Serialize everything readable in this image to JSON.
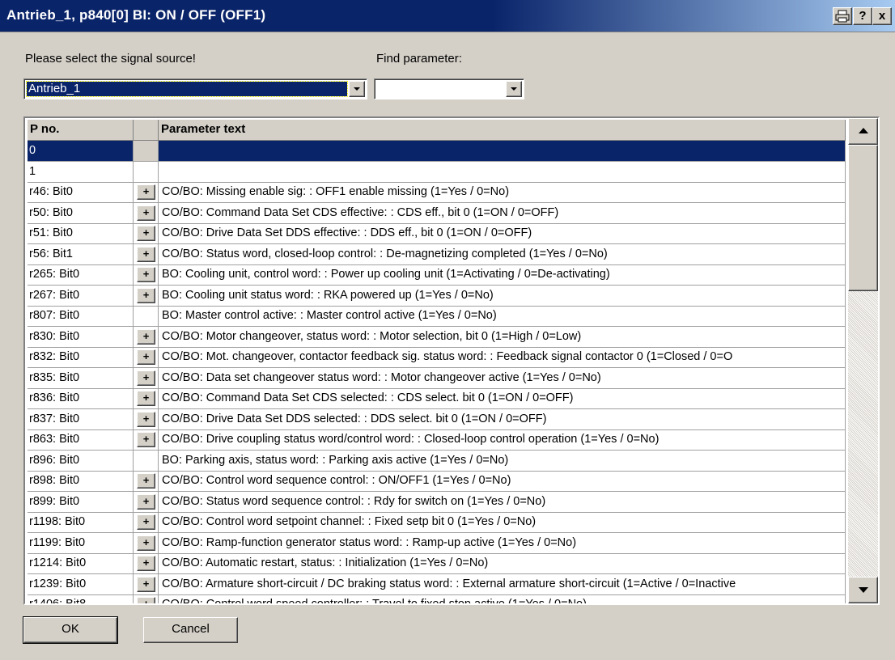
{
  "window": {
    "title": "Antrieb_1, p840[0] BI: ON / OFF (OFF1)",
    "buttons": {
      "print_icon": "printer-icon",
      "help": "?",
      "close": "x"
    }
  },
  "source": {
    "label": "Please select the signal source!",
    "value": "Antrieb_1"
  },
  "find": {
    "label": "Find parameter:",
    "value": ""
  },
  "table": {
    "columns": [
      "P no.",
      "",
      "Parameter text"
    ],
    "rows": [
      {
        "pno": "0",
        "expand": false,
        "text": "",
        "selected": true
      },
      {
        "pno": "1",
        "expand": false,
        "text": ""
      },
      {
        "pno": "r46: Bit0",
        "expand": true,
        "text": "CO/BO: Missing enable sig: : OFF1 enable missing (1=Yes / 0=No)"
      },
      {
        "pno": "r50: Bit0",
        "expand": true,
        "text": "CO/BO: Command Data Set CDS effective: : CDS eff., bit 0 (1=ON / 0=OFF)"
      },
      {
        "pno": "r51: Bit0",
        "expand": true,
        "text": "CO/BO: Drive Data Set DDS effective: : DDS eff., bit 0 (1=ON / 0=OFF)"
      },
      {
        "pno": "r56: Bit1",
        "expand": true,
        "text": "CO/BO: Status word, closed-loop control: : De-magnetizing completed (1=Yes / 0=No)"
      },
      {
        "pno": "r265: Bit0",
        "expand": true,
        "text": "BO: Cooling unit, control word: : Power up cooling unit (1=Activating / 0=De-activating)"
      },
      {
        "pno": "r267: Bit0",
        "expand": true,
        "text": "BO: Cooling unit status word: : RKA powered up (1=Yes / 0=No)"
      },
      {
        "pno": "r807: Bit0",
        "expand": false,
        "text": "BO: Master control active: : Master control active (1=Yes / 0=No)"
      },
      {
        "pno": "r830: Bit0",
        "expand": true,
        "text": "CO/BO: Motor changeover, status word: : Motor selection, bit 0 (1=High / 0=Low)"
      },
      {
        "pno": "r832: Bit0",
        "expand": true,
        "text": "CO/BO: Mot. changeover, contactor feedback sig. status word: : Feedback signal contactor 0 (1=Closed / 0=O"
      },
      {
        "pno": "r835: Bit0",
        "expand": true,
        "text": "CO/BO: Data set changeover status word: : Motor changeover active (1=Yes / 0=No)"
      },
      {
        "pno": "r836: Bit0",
        "expand": true,
        "text": "CO/BO: Command Data Set CDS selected: : CDS select. bit 0 (1=ON / 0=OFF)"
      },
      {
        "pno": "r837: Bit0",
        "expand": true,
        "text": "CO/BO: Drive Data Set DDS selected: : DDS select. bit 0 (1=ON / 0=OFF)"
      },
      {
        "pno": "r863: Bit0",
        "expand": true,
        "text": "CO/BO: Drive coupling status word/control word: : Closed-loop control operation (1=Yes / 0=No)"
      },
      {
        "pno": "r896: Bit0",
        "expand": false,
        "text": "BO: Parking axis, status word: : Parking axis active (1=Yes / 0=No)"
      },
      {
        "pno": "r898: Bit0",
        "expand": true,
        "text": "CO/BO: Control word sequence control: : ON/OFF1 (1=Yes / 0=No)"
      },
      {
        "pno": "r899: Bit0",
        "expand": true,
        "text": "CO/BO: Status word sequence control: : Rdy for switch on (1=Yes / 0=No)"
      },
      {
        "pno": "r1198: Bit0",
        "expand": true,
        "text": "CO/BO: Control word setpoint channel: : Fixed setp bit 0 (1=Yes / 0=No)"
      },
      {
        "pno": "r1199: Bit0",
        "expand": true,
        "text": "CO/BO: Ramp-function generator status word: : Ramp-up active (1=Yes / 0=No)"
      },
      {
        "pno": "r1214: Bit0",
        "expand": true,
        "text": "CO/BO: Automatic restart, status: : Initialization (1=Yes / 0=No)"
      },
      {
        "pno": "r1239: Bit0",
        "expand": true,
        "text": "CO/BO: Armature short-circuit / DC braking status word: : External armature short-circuit (1=Active / 0=Inactive"
      },
      {
        "pno": "r1406: Bit8",
        "expand": true,
        "text": "CO/BO: Control word speed controller: : Travel to fixed stop active (1=Yes / 0=No)"
      }
    ],
    "expand_symbol": "+"
  },
  "actions": {
    "ok": "OK",
    "cancel": "Cancel"
  },
  "colors": {
    "selection": "#0a246a",
    "dialog_bg": "#d4d0c8"
  }
}
